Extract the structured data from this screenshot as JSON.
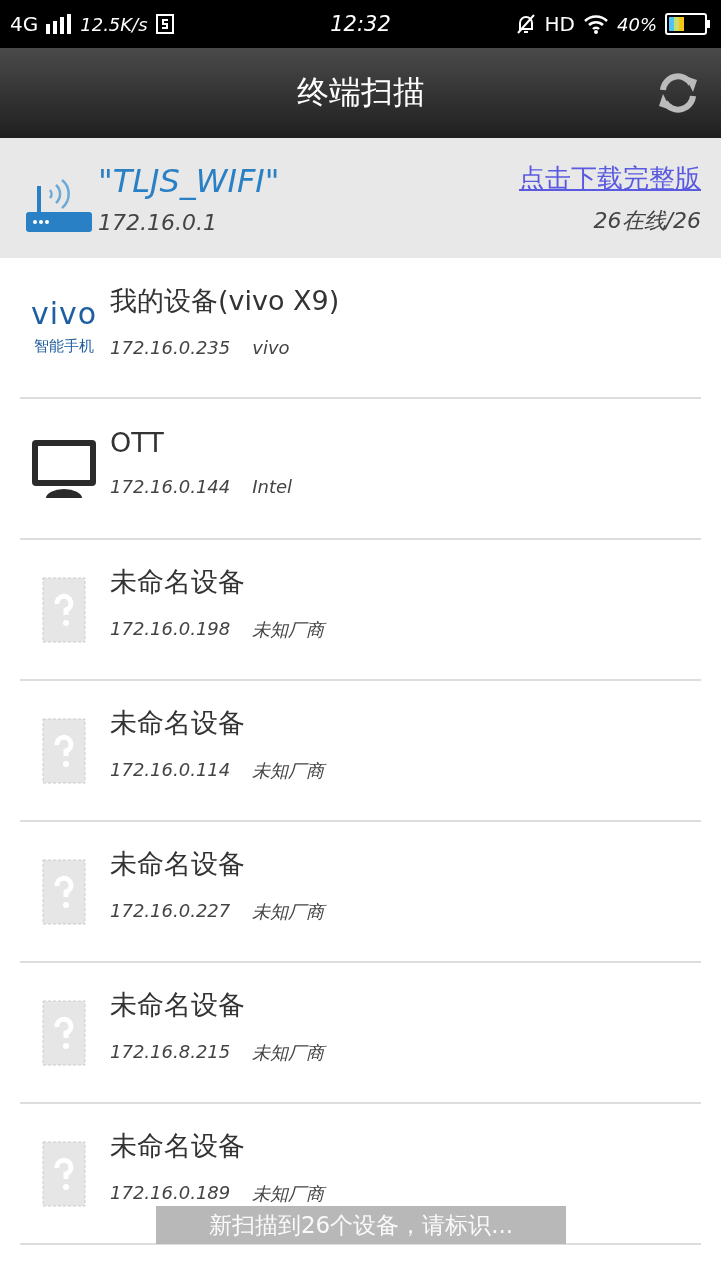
{
  "status_bar": {
    "network": "4G",
    "speed": "12.5K/s",
    "time": "12:32",
    "hd": "HD",
    "battery": "40%"
  },
  "toolbar": {
    "title": "终端扫描"
  },
  "network": {
    "ssid": "\"TLJS_WIFI\"",
    "gateway": "172.16.0.1",
    "download_link": "点击下载完整版",
    "online": "26在线/26"
  },
  "devices": [
    {
      "kind": "vivo",
      "logo_text": "vivo",
      "logo_caption": "智能手机",
      "name": "我的设备(vivo X9)",
      "ip": "172.16.0.235",
      "vendor": "vivo"
    },
    {
      "kind": "monitor",
      "name": "OTT",
      "ip": "172.16.0.144",
      "vendor": "Intel"
    },
    {
      "kind": "unknown",
      "name": "未命名设备",
      "ip": "172.16.0.198",
      "vendor": "未知厂商"
    },
    {
      "kind": "unknown",
      "name": "未命名设备",
      "ip": "172.16.0.114",
      "vendor": "未知厂商"
    },
    {
      "kind": "unknown",
      "name": "未命名设备",
      "ip": "172.16.0.227",
      "vendor": "未知厂商"
    },
    {
      "kind": "unknown",
      "name": "未命名设备",
      "ip": "172.16.8.215",
      "vendor": "未知厂商"
    },
    {
      "kind": "unknown",
      "name": "未命名设备",
      "ip": "172.16.0.189",
      "vendor": "未知厂商"
    }
  ],
  "toast": "新扫描到26个设备，请标识..."
}
